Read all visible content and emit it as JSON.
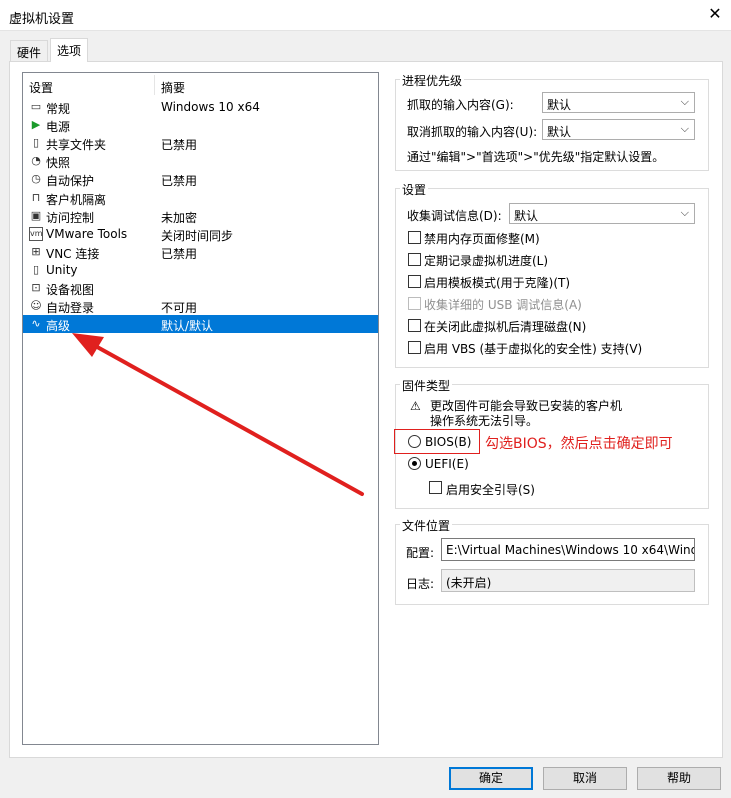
{
  "window": {
    "title": "虚拟机设置",
    "close_glyph": "✕"
  },
  "tabs": [
    {
      "label": "硬件",
      "active": false
    },
    {
      "label": "选项",
      "active": true
    }
  ],
  "list": {
    "headers": {
      "setting": "设置",
      "summary": "摘要"
    },
    "rows": [
      {
        "icon": "monitor-icon",
        "glyph": "▭",
        "name": "常规",
        "value": "Windows 10 x64"
      },
      {
        "icon": "play-icon",
        "glyph": "▶",
        "name": "电源",
        "value": ""
      },
      {
        "icon": "shared-folder-icon",
        "glyph": "▯",
        "name": "共享文件夹",
        "value": "已禁用"
      },
      {
        "icon": "snapshot-icon",
        "glyph": "◔",
        "name": "快照",
        "value": ""
      },
      {
        "icon": "autoprotect-icon",
        "glyph": "◷",
        "name": "自动保护",
        "value": "已禁用"
      },
      {
        "icon": "lock-icon",
        "glyph": "⊓",
        "name": "客户机隔离",
        "value": ""
      },
      {
        "icon": "access-control-icon",
        "glyph": "▣",
        "name": "访问控制",
        "value": "未加密"
      },
      {
        "icon": "vmware-tools-icon",
        "glyph": "vm",
        "name": "VMware Tools",
        "value": "关闭时间同步"
      },
      {
        "icon": "vnc-icon",
        "glyph": "⊞",
        "name": "VNC 连接",
        "value": "已禁用"
      },
      {
        "icon": "unity-icon",
        "glyph": "▯",
        "name": "Unity",
        "value": ""
      },
      {
        "icon": "device-view-icon",
        "glyph": "⊡",
        "name": "设备视图",
        "value": ""
      },
      {
        "icon": "auto-login-icon",
        "glyph": "☺",
        "name": "自动登录",
        "value": "不可用"
      },
      {
        "icon": "advanced-icon",
        "glyph": "∿",
        "name": "高级",
        "value": "默认/默认",
        "selected": true
      }
    ]
  },
  "process_priority": {
    "label": "进程优先级",
    "grabbed_label": "抓取的输入内容(G):",
    "grabbed_value": "默认",
    "ungrabbed_label": "取消抓取的输入内容(U):",
    "ungrabbed_value": "默认",
    "hint": "通过\"编辑\">\"首选项\">\"优先级\"指定默认设置。"
  },
  "settings": {
    "label": "设置",
    "debug_label": "收集调试信息(D):",
    "debug_value": "默认",
    "checks": [
      {
        "label": "禁用内存页面修整(M)",
        "disabled": false
      },
      {
        "label": "定期记录虚拟机进度(L)",
        "disabled": false
      },
      {
        "label": "启用模板模式(用于克隆)(T)",
        "disabled": false
      },
      {
        "label": "收集详细的 USB 调试信息(A)",
        "disabled": true
      },
      {
        "label": "在关闭此虚拟机后清理磁盘(N)",
        "disabled": false
      },
      {
        "label": "启用 VBS (基于虚拟化的安全性) 支持(V)",
        "disabled": false
      }
    ]
  },
  "firmware": {
    "label": "固件类型",
    "warning_glyph": "⚠",
    "warning": "更改固件可能会导致已安装的客户机操作系统无法引导。",
    "bios_label": "BIOS(B)",
    "uefi_label": "UEFI(E)",
    "secure_boot_label": "启用安全引导(S)"
  },
  "annotation": {
    "text": "勾选BIOS，然后点击确定即可",
    "color": "#e0201e"
  },
  "file_location": {
    "label": "文件位置",
    "config_label": "配置:",
    "config_value": "E:\\Virtual Machines\\Windows 10 x64\\Windov",
    "log_label": "日志:",
    "log_value": "(未开启)"
  },
  "buttons": {
    "ok": "确定",
    "cancel": "取消",
    "help": "帮助"
  },
  "colors": {
    "selection": "#0078d7",
    "annotation": "#e0201e"
  }
}
